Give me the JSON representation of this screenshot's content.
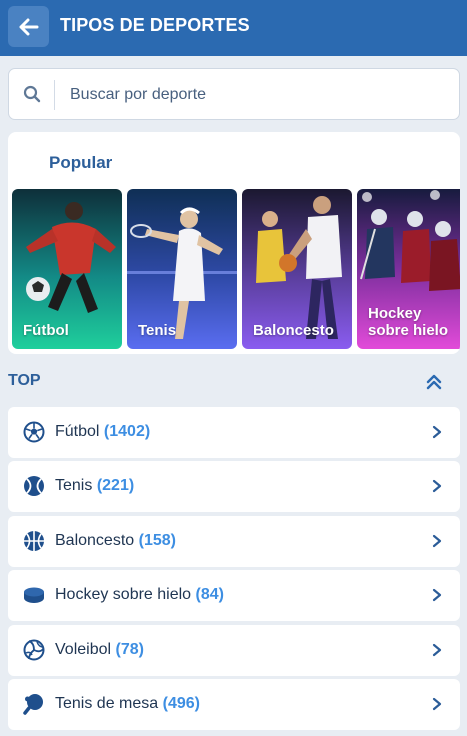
{
  "header": {
    "title": "TIPOS DE DEPORTES"
  },
  "search": {
    "placeholder": "Buscar por deporte"
  },
  "popular": {
    "title": "Popular",
    "cards": [
      {
        "label": "Fútbol"
      },
      {
        "label": "Tenis"
      },
      {
        "label": "Baloncesto"
      },
      {
        "label": "Hockey sobre hielo"
      }
    ]
  },
  "top": {
    "title": "TOP",
    "items": [
      {
        "name": "Fútbol",
        "count": "(1402)",
        "icon": "soccer-ball-icon"
      },
      {
        "name": "Tenis",
        "count": "(221)",
        "icon": "tennis-ball-icon"
      },
      {
        "name": "Baloncesto",
        "count": "(158)",
        "icon": "basketball-icon"
      },
      {
        "name": "Hockey sobre hielo",
        "count": "(84)",
        "icon": "hockey-puck-icon"
      },
      {
        "name": "Voleibol",
        "count": "(78)",
        "icon": "volleyball-icon"
      },
      {
        "name": "Tenis de mesa",
        "count": "(496)",
        "icon": "table-tennis-icon"
      }
    ]
  },
  "colors": {
    "header": "#2b6ab1",
    "accent": "#3d8ee2",
    "title": "#2d5f9a",
    "background": "#e8edf3"
  }
}
